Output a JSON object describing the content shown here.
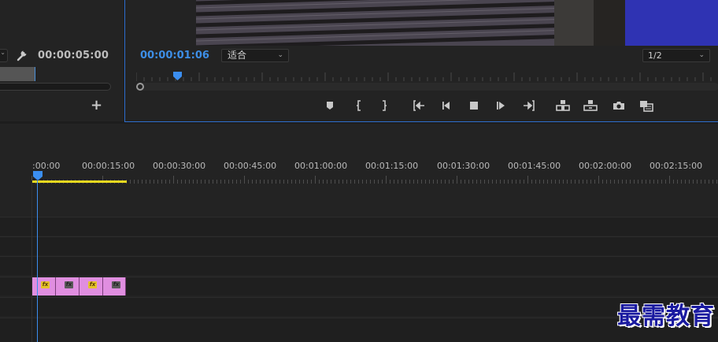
{
  "source_monitor": {
    "timecode": "00:00:05:00",
    "add_label": "+"
  },
  "program_monitor": {
    "timecode": "00:00:01:06",
    "fit_option": "适合",
    "resolution_option": "1/2",
    "transport_buttons": [
      "add-marker",
      "mark-in",
      "mark-out",
      "go-to-in",
      "step-back",
      "stop",
      "step-forward",
      "go-to-out",
      "lift",
      "extract",
      "export-frame",
      "comparison-view"
    ]
  },
  "timeline": {
    "timecodes": [
      ":00:00",
      "00:00:15:00",
      "00:00:30:00",
      "00:00:45:00",
      "00:01:00:00",
      "00:01:15:00",
      "00:01:30:00",
      "00:01:45:00",
      "00:02:00:00",
      "00:02:15:00"
    ],
    "clips": [
      {
        "fx": "fx",
        "fx_active": true
      },
      {
        "fx": "fx",
        "fx_active": false
      },
      {
        "fx": "fx",
        "fx_active": true
      },
      {
        "fx": "fx",
        "fx_active": false
      }
    ]
  },
  "colors": {
    "accent_blue": "#3b8ef0",
    "work_area_yellow": "#e8d91f",
    "clip_pink": "#e08ee0"
  },
  "watermark": "最需教育"
}
